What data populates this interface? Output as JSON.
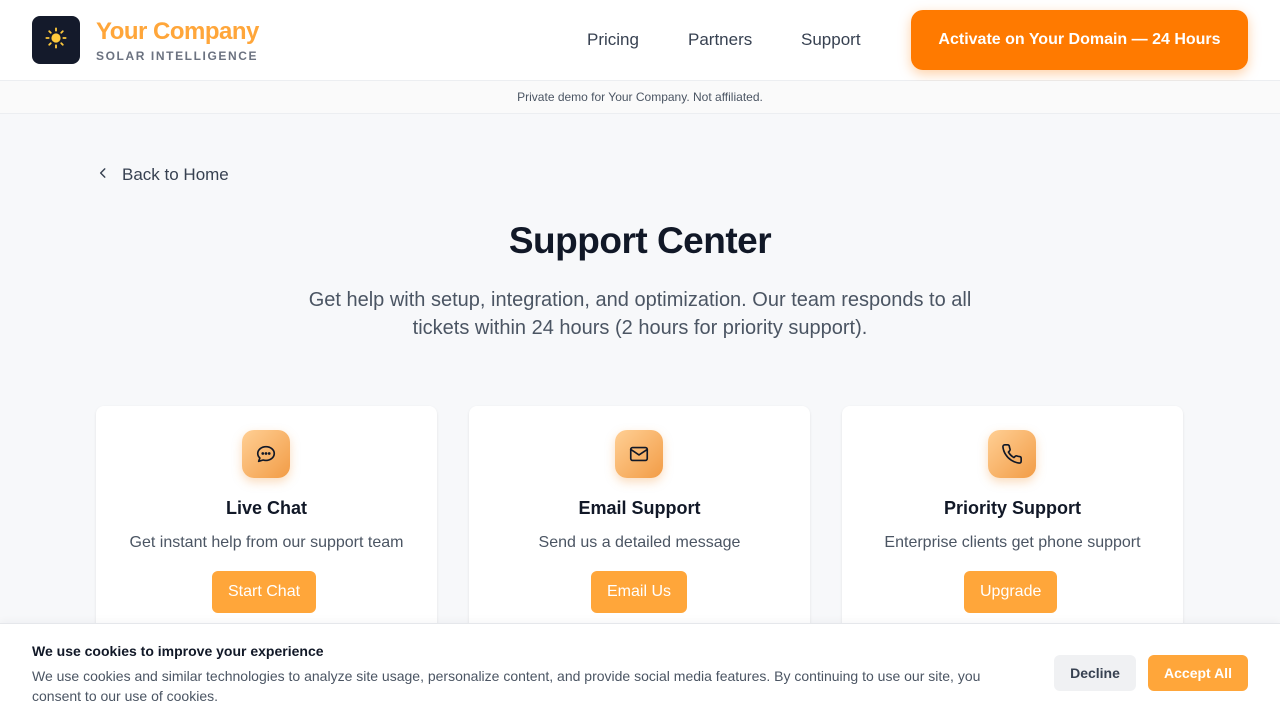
{
  "brand": {
    "name": "Your Company",
    "tagline": "SOLAR INTELLIGENCE",
    "logo_icon": "sun-icon",
    "accent_color": "#ffa63a"
  },
  "nav": {
    "links": [
      "Pricing",
      "Partners",
      "Support"
    ],
    "cta_label": "Activate on Your Domain — 24 Hours",
    "cta_color": "#ff7a00"
  },
  "notice": "Private demo for Your Company. Not affiliated.",
  "back_label": "Back to Home",
  "page": {
    "title": "Support Center",
    "subtitle": "Get help with setup, integration, and optimization. Our team responds to all tickets within 24 hours (2 hours for priority support)."
  },
  "cards": [
    {
      "icon": "chat-bubble-icon",
      "title": "Live Chat",
      "description": "Get instant help from our support team",
      "button": "Start Chat"
    },
    {
      "icon": "envelope-icon",
      "title": "Email Support",
      "description": "Send us a detailed message",
      "button": "Email Us"
    },
    {
      "icon": "phone-icon",
      "title": "Priority Support",
      "description": "Enterprise clients get phone support",
      "button": "Upgrade"
    }
  ],
  "cookie": {
    "title": "We use cookies to improve your experience",
    "text": "We use cookies and similar technologies to analyze site usage, personalize content, and provide social media features. By continuing to use our site, you consent to our use of cookies.",
    "decline_label": "Decline",
    "accept_label": "Accept All"
  }
}
